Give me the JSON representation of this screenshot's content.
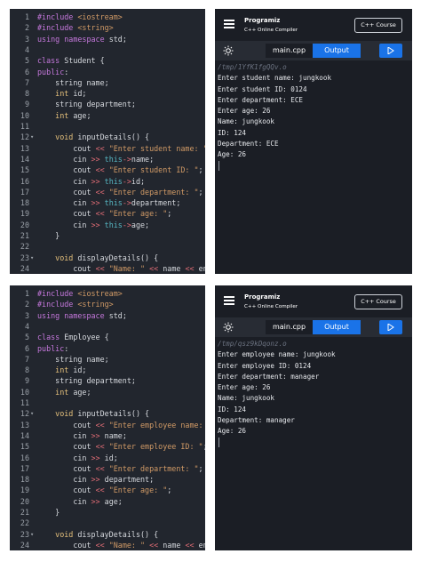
{
  "screens": [
    {
      "editor": {
        "lines": [
          {
            "n": "1",
            "f": "",
            "t": [
              [
                "kw-pp",
                "#include "
              ],
              [
                "str",
                "<iostream>"
              ]
            ]
          },
          {
            "n": "2",
            "f": "",
            "t": [
              [
                "kw-pp",
                "#include "
              ],
              [
                "str",
                "<string>"
              ]
            ]
          },
          {
            "n": "3",
            "f": "",
            "t": [
              [
                "kw-pp",
                "using namespace "
              ],
              [
                "",
                "std;"
              ]
            ]
          },
          {
            "n": "4",
            "f": "",
            "t": []
          },
          {
            "n": "5",
            "f": "",
            "t": [
              [
                "kw-pp",
                "class "
              ],
              [
                "",
                "Student {"
              ]
            ]
          },
          {
            "n": "6",
            "f": "",
            "t": [
              [
                "kw-pp",
                "public"
              ],
              [
                "",
                ":"
              ]
            ]
          },
          {
            "n": "7",
            "f": "",
            "t": [
              [
                "",
                "    string name;"
              ]
            ]
          },
          {
            "n": "8",
            "f": "",
            "t": [
              [
                "kw",
                "    int "
              ],
              [
                "",
                "id;"
              ]
            ]
          },
          {
            "n": "9",
            "f": "",
            "t": [
              [
                "",
                "    string department;"
              ]
            ]
          },
          {
            "n": "10",
            "f": "",
            "t": [
              [
                "kw",
                "    int "
              ],
              [
                "",
                "age;"
              ]
            ]
          },
          {
            "n": "11",
            "f": "",
            "t": []
          },
          {
            "n": "12",
            "f": "▾",
            "t": [
              [
                "kw",
                "    void "
              ],
              [
                "",
                "inputDetails() {"
              ]
            ]
          },
          {
            "n": "13",
            "f": "",
            "t": [
              [
                "",
                "        cout "
              ],
              [
                "arrow",
                "<< "
              ],
              [
                "str",
                "\"Enter student name: \""
              ],
              [
                "",
                ";"
              ]
            ]
          },
          {
            "n": "14",
            "f": "",
            "t": [
              [
                "",
                "        cin "
              ],
              [
                "arrow",
                ">> "
              ],
              [
                "this",
                "this"
              ],
              [
                "arrow",
                "->"
              ],
              [
                "",
                "name;"
              ]
            ]
          },
          {
            "n": "15",
            "f": "",
            "t": [
              [
                "",
                "        cout "
              ],
              [
                "arrow",
                "<< "
              ],
              [
                "str",
                "\"Enter student ID: \""
              ],
              [
                "",
                ";"
              ]
            ]
          },
          {
            "n": "16",
            "f": "",
            "t": [
              [
                "",
                "        cin "
              ],
              [
                "arrow",
                ">> "
              ],
              [
                "this",
                "this"
              ],
              [
                "arrow",
                "->"
              ],
              [
                "",
                "id;"
              ]
            ]
          },
          {
            "n": "17",
            "f": "",
            "t": [
              [
                "",
                "        cout "
              ],
              [
                "arrow",
                "<< "
              ],
              [
                "str",
                "\"Enter department: \""
              ],
              [
                "",
                ";"
              ]
            ]
          },
          {
            "n": "18",
            "f": "",
            "t": [
              [
                "",
                "        cin "
              ],
              [
                "arrow",
                ">> "
              ],
              [
                "this",
                "this"
              ],
              [
                "arrow",
                "->"
              ],
              [
                "",
                "department;"
              ]
            ]
          },
          {
            "n": "19",
            "f": "",
            "t": [
              [
                "",
                "        cout "
              ],
              [
                "arrow",
                "<< "
              ],
              [
                "str",
                "\"Enter age: \""
              ],
              [
                "",
                ";"
              ]
            ]
          },
          {
            "n": "20",
            "f": "",
            "t": [
              [
                "",
                "        cin "
              ],
              [
                "arrow",
                ">> "
              ],
              [
                "this",
                "this"
              ],
              [
                "arrow",
                "->"
              ],
              [
                "",
                "age;"
              ]
            ]
          },
          {
            "n": "21",
            "f": "",
            "t": [
              [
                "",
                "    }"
              ]
            ]
          },
          {
            "n": "22",
            "f": "",
            "t": []
          },
          {
            "n": "23",
            "f": "▾",
            "t": [
              [
                "kw",
                "    void "
              ],
              [
                "",
                "displayDetails() {"
              ]
            ]
          },
          {
            "n": "24",
            "f": "",
            "t": [
              [
                "",
                "        cout "
              ],
              [
                "arrow",
                "<< "
              ],
              [
                "str",
                "\"Name: \" "
              ],
              [
                "arrow",
                "<< "
              ],
              [
                "",
                "name "
              ],
              [
                "arrow",
                "<< "
              ],
              [
                "",
                "endl"
              ]
            ]
          }
        ]
      },
      "panel": {
        "logo": "Programiz",
        "logo_sub": "C++ Online Compiler",
        "course_button": "C++ Course",
        "file_tab": "main.cpp",
        "output_tab": "Output",
        "path": "/tmp/1YfK1fgQQv.o",
        "output": [
          "Enter student name: jungkook",
          "Enter student ID: 0124",
          "Enter department: ECE",
          "Enter age: 26",
          "Name: jungkook",
          "ID: 124",
          "Department: ECE",
          "Age: 26"
        ]
      }
    },
    {
      "editor": {
        "lines": [
          {
            "n": "1",
            "f": "",
            "t": [
              [
                "kw-pp",
                "#include "
              ],
              [
                "str",
                "<iostream>"
              ]
            ]
          },
          {
            "n": "2",
            "f": "",
            "t": [
              [
                "kw-pp",
                "#include "
              ],
              [
                "str",
                "<string>"
              ]
            ]
          },
          {
            "n": "3",
            "f": "",
            "t": [
              [
                "kw-pp",
                "using namespace "
              ],
              [
                "",
                "std;"
              ]
            ]
          },
          {
            "n": "4",
            "f": "",
            "t": []
          },
          {
            "n": "5",
            "f": "",
            "t": [
              [
                "kw-pp",
                "class "
              ],
              [
                "",
                "Employee {"
              ]
            ]
          },
          {
            "n": "6",
            "f": "",
            "t": [
              [
                "kw-pp",
                "public"
              ],
              [
                "",
                ":"
              ]
            ]
          },
          {
            "n": "7",
            "f": "",
            "t": [
              [
                "",
                "    string name;"
              ]
            ]
          },
          {
            "n": "8",
            "f": "",
            "t": [
              [
                "kw",
                "    int "
              ],
              [
                "",
                "id;"
              ]
            ]
          },
          {
            "n": "9",
            "f": "",
            "t": [
              [
                "",
                "    string department;"
              ]
            ]
          },
          {
            "n": "10",
            "f": "",
            "t": [
              [
                "kw",
                "    int "
              ],
              [
                "",
                "age;"
              ]
            ]
          },
          {
            "n": "11",
            "f": "",
            "t": []
          },
          {
            "n": "12",
            "f": "▾",
            "t": [
              [
                "kw",
                "    void "
              ],
              [
                "",
                "inputDetails() {"
              ]
            ]
          },
          {
            "n": "13",
            "f": "",
            "t": [
              [
                "",
                "        cout "
              ],
              [
                "arrow",
                "<< "
              ],
              [
                "str",
                "\"Enter employee name: \""
              ],
              [
                "",
                ";"
              ]
            ]
          },
          {
            "n": "14",
            "f": "",
            "t": [
              [
                "",
                "        cin "
              ],
              [
                "arrow",
                ">> "
              ],
              [
                "",
                "name;"
              ]
            ]
          },
          {
            "n": "15",
            "f": "",
            "t": [
              [
                "",
                "        cout "
              ],
              [
                "arrow",
                "<< "
              ],
              [
                "str",
                "\"Enter employee ID: \""
              ],
              [
                "",
                ";"
              ]
            ]
          },
          {
            "n": "16",
            "f": "",
            "t": [
              [
                "",
                "        cin "
              ],
              [
                "arrow",
                ">> "
              ],
              [
                "",
                "id;"
              ]
            ]
          },
          {
            "n": "17",
            "f": "",
            "t": [
              [
                "",
                "        cout "
              ],
              [
                "arrow",
                "<< "
              ],
              [
                "str",
                "\"Enter department: \""
              ],
              [
                "",
                ";"
              ]
            ]
          },
          {
            "n": "18",
            "f": "",
            "t": [
              [
                "",
                "        cin "
              ],
              [
                "arrow",
                ">> "
              ],
              [
                "",
                "department;"
              ]
            ]
          },
          {
            "n": "19",
            "f": "",
            "t": [
              [
                "",
                "        cout "
              ],
              [
                "arrow",
                "<< "
              ],
              [
                "str",
                "\"Enter age: \""
              ],
              [
                "",
                ";"
              ]
            ]
          },
          {
            "n": "20",
            "f": "",
            "t": [
              [
                "",
                "        cin "
              ],
              [
                "arrow",
                ">> "
              ],
              [
                "",
                "age;"
              ]
            ]
          },
          {
            "n": "21",
            "f": "",
            "t": [
              [
                "",
                "    }"
              ]
            ]
          },
          {
            "n": "22",
            "f": "",
            "t": []
          },
          {
            "n": "23",
            "f": "▾",
            "t": [
              [
                "kw",
                "    void "
              ],
              [
                "",
                "displayDetails() {"
              ]
            ]
          },
          {
            "n": "24",
            "f": "",
            "t": [
              [
                "",
                "        cout "
              ],
              [
                "arrow",
                "<< "
              ],
              [
                "str",
                "\"Name: \" "
              ],
              [
                "arrow",
                "<< "
              ],
              [
                "",
                "name "
              ],
              [
                "arrow",
                "<< "
              ],
              [
                "",
                "endl"
              ]
            ]
          }
        ]
      },
      "panel": {
        "logo": "Programiz",
        "logo_sub": "C++ Online Compiler",
        "course_button": "C++ Course",
        "file_tab": "main.cpp",
        "output_tab": "Output",
        "path": "/tmp/qsz9kDqonz.o",
        "output": [
          "Enter employee name: jungkook",
          "Enter employee ID: 0124",
          "Enter department: manager",
          "Enter age: 26",
          "Name: jungkook",
          "ID: 124",
          "Department: manager",
          "Age: 26"
        ]
      }
    }
  ],
  "icons": {
    "menu": "menu-icon",
    "theme": "sun-icon",
    "run": "play-icon"
  },
  "colors": {
    "editor_bg": "#22262e",
    "panel_bg": "#1b1e25",
    "accent": "#1a73e8"
  }
}
